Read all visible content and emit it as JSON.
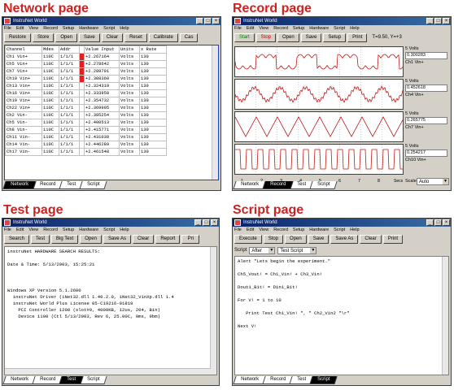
{
  "headings": {
    "network": "Network page",
    "record": "Record page",
    "test": "Test page",
    "script": "Script page"
  },
  "app_title": "InstruNet World",
  "window_buttons": [
    "_",
    "□",
    "×"
  ],
  "menu": [
    "File",
    "Edit",
    "View",
    "Record",
    "Setup",
    "Hardware",
    "Script",
    "Help"
  ],
  "tabs": [
    "Network",
    "Record",
    "Test",
    "Script"
  ],
  "network": {
    "toolbar": [
      "Restore",
      "Store",
      "Open",
      "Save",
      "Clear",
      "Reset",
      "Calibrate",
      "Cas"
    ],
    "columns": [
      "Channel",
      "Mdes",
      "Addr",
      "Value Input",
      "Units",
      "x Rate"
    ],
    "rows": [
      [
        "Ch1 Vin+",
        "110C",
        "1/1/1",
        "+2.267164",
        "Volts",
        "130"
      ],
      [
        "Ch5 Vin+",
        "110C",
        "1/1/1",
        "+2.278642",
        "Volts",
        "130"
      ],
      [
        "Ch7 Vin+",
        "110C",
        "1/1/1",
        "+2.289791",
        "Volts",
        "130"
      ],
      [
        "Ch10 Vin+",
        "110C",
        "1/1/1",
        "+2.308360",
        "Volts",
        "130"
      ],
      [
        "Ch13 Vin+",
        "110C",
        "1/1/1",
        "+2.324319",
        "Volts",
        "130"
      ],
      [
        "Ch16 Vin+",
        "110C",
        "1/1/1",
        "+2.333958",
        "Volts",
        "130"
      ],
      [
        "Ch19 Vin+",
        "110C",
        "1/1/1",
        "+2.354732",
        "Volts",
        "130"
      ],
      [
        "Ch22 Vin+",
        "110C",
        "1/1/1",
        "+2.369995",
        "Volts",
        "130"
      ],
      [
        "Ch2 Vin-",
        "110C",
        "1/1/1",
        "+2.385254",
        "Volts",
        "130"
      ],
      [
        "Ch5 Vin-",
        "110C",
        "1/1/1",
        "+2.400513",
        "Volts",
        "130"
      ],
      [
        "Ch8 Vin-",
        "110C",
        "1/1/1",
        "+2.415771",
        "Volts",
        "130"
      ],
      [
        "Ch11 Vin-",
        "110C",
        "1/1/1",
        "+2.431030",
        "Volts",
        "130"
      ],
      [
        "Ch14 Vin-",
        "110C",
        "1/1/1",
        "+2.446289",
        "Volts",
        "130"
      ],
      [
        "Ch17 Vin-",
        "110C",
        "1/1/1",
        "+2.461548",
        "Volts",
        "130"
      ]
    ],
    "red_rows": [
      0,
      1,
      2,
      3
    ]
  },
  "record": {
    "toolbar": [
      "Start",
      "Stop",
      "Open",
      "Save",
      "Setup",
      "Print"
    ],
    "coord_readout": "T=9.50, Y=+3",
    "channels": [
      {
        "volts": "5 Volts",
        "value": "0.300283",
        "name": "Ch1 Vin+"
      },
      {
        "volts": "5 Volts",
        "value": "0.452618",
        "name": "Ch4 Vin+"
      },
      {
        "volts": "5 Volts",
        "value": "0.265775",
        "name": "Ch7 Vin+"
      },
      {
        "volts": "5 Volts",
        "value": "0.254217",
        "name": "Ch10 Vin+"
      }
    ],
    "x_ticks": [
      "1",
      "2",
      "3",
      "4",
      "5",
      "6",
      "7",
      "8"
    ],
    "x_unit": "Secs",
    "scale_label": "Scale",
    "scale_value": "Auto"
  },
  "test": {
    "toolbar": [
      "Search",
      "Test",
      "Big Text",
      "Open",
      "Save As",
      "Clear",
      "Report",
      "Pri"
    ],
    "lines": [
      "instruNet HARDWARE SEARCH RESULTS:",
      "",
      "Date & Time: 5/13/2003, 15:25:21",
      "",
      "",
      "",
      "Windows XP Version 5.1.2600",
      "  instruNet Driver (iNet32.dll 1.40.2.0, iNet32_VinXp.dll 1.4",
      "  instruNet World Plus License 05-C19216-01819",
      "    PCI Controller 1200 (slot#9, 4000KB, 12us, 204, Bin)",
      "    Device 1100 (Ctl 5/13/2003, Rev 6, 25.00C, 0ms, 9bm)"
    ]
  },
  "script": {
    "toolbar": [
      "Execute",
      "Stop",
      "Open",
      "Save",
      "Save As",
      "Clear",
      "Print"
    ],
    "script_label": "Script",
    "script_select": "After",
    "test_select": "Test Script",
    "lines": [
      "Alert \"Lets begin the experiment.\"",
      "",
      "Ch5_Vout! = Ch1_Vin! + Ch3_Vin!",
      "",
      "Dout1_Bit! = Din1_Bit!",
      "",
      "For V! = 1 to 10",
      "",
      "   Print Test Ch1_Vin! \", \" Ch2_Vin2 \"\\r\"",
      "",
      "Next V!"
    ]
  },
  "colors": {
    "heading": "#d02020",
    "titlebar": "#0a246a",
    "trace": "#c01818",
    "chart_border": "#2040c0"
  }
}
